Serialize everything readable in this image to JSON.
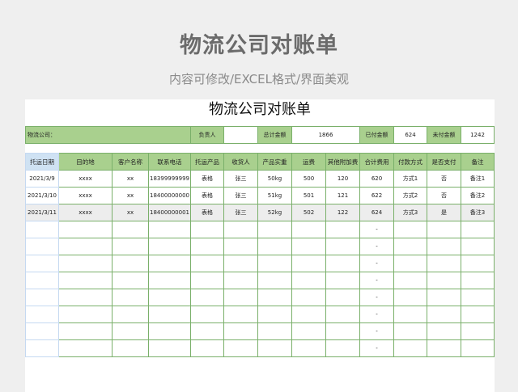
{
  "header": {
    "title": "物流公司对账单",
    "subtitle": "内容可修改/EXCEL格式/界面美观"
  },
  "sheet": {
    "title": "物流公司对账单",
    "info": {
      "company_label": "物流公司：",
      "responsible_label": "负责人",
      "responsible_value": "",
      "total_label": "总计金额",
      "total_value": "1866",
      "paid_label": "已付金额",
      "paid_value": "624",
      "unpaid_label": "未付金额",
      "unpaid_value": "1242"
    },
    "columns": [
      "托运日期",
      "目的地",
      "客户名称",
      "联系电话",
      "托运产品",
      "收货人",
      "产品实重",
      "运费",
      "其他附加费",
      "合计费用",
      "付款方式",
      "是否支付",
      "备注"
    ],
    "rows": [
      [
        "2021/3/9",
        "xxxx",
        "xx",
        "18399999999",
        "表格",
        "张三",
        "50kg",
        "500",
        "120",
        "620",
        "方式1",
        "否",
        "备注1"
      ],
      [
        "2021/3/10",
        "xxxx",
        "xx",
        "18400000000",
        "表格",
        "张三",
        "51kg",
        "501",
        "121",
        "622",
        "方式2",
        "否",
        "备注2"
      ],
      [
        "2021/3/11",
        "xxxx",
        "xx",
        "18400000001",
        "表格",
        "张三",
        "52kg",
        "502",
        "122",
        "624",
        "方式3",
        "是",
        "备注3"
      ],
      [
        "",
        "",
        "",
        "",
        "",
        "",
        "",
        "",
        "",
        "-",
        "",
        "",
        ""
      ],
      [
        "",
        "",
        "",
        "",
        "",
        "",
        "",
        "",
        "",
        "-",
        "",
        "",
        ""
      ],
      [
        "",
        "",
        "",
        "",
        "",
        "",
        "",
        "",
        "",
        "-",
        "",
        "",
        ""
      ],
      [
        "",
        "",
        "",
        "",
        "",
        "",
        "",
        "",
        "",
        "-",
        "",
        "",
        ""
      ],
      [
        "",
        "",
        "",
        "",
        "",
        "",
        "",
        "",
        "",
        "-",
        "",
        "",
        ""
      ],
      [
        "",
        "",
        "",
        "",
        "",
        "",
        "",
        "",
        "",
        "-",
        "",
        "",
        ""
      ],
      [
        "",
        "",
        "",
        "",
        "",
        "",
        "",
        "",
        "",
        "-",
        "",
        "",
        ""
      ],
      [
        "",
        "",
        "",
        "",
        "",
        "",
        "",
        "",
        "",
        "-",
        "",
        "",
        ""
      ]
    ]
  }
}
